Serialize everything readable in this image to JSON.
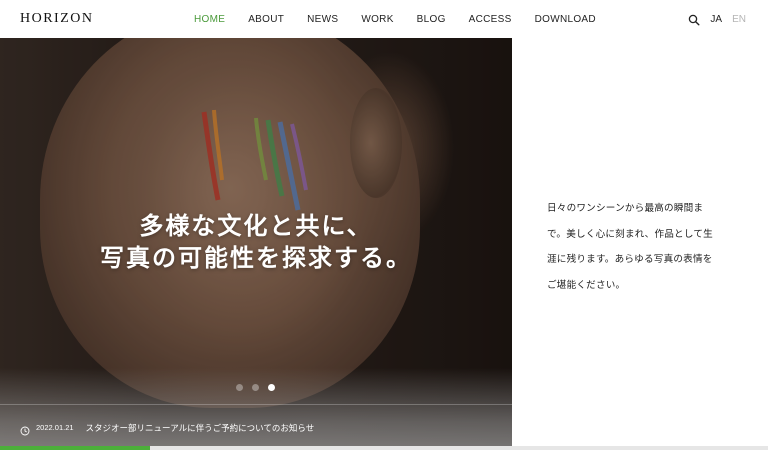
{
  "header": {
    "logo": "HORIZON",
    "nav": [
      {
        "label": "HOME",
        "active": true
      },
      {
        "label": "ABOUT",
        "active": false
      },
      {
        "label": "NEWS",
        "active": false
      },
      {
        "label": "WORK",
        "active": false
      },
      {
        "label": "BLOG",
        "active": false
      },
      {
        "label": "ACCESS",
        "active": false
      },
      {
        "label": "DOWNLOAD",
        "active": false
      }
    ],
    "search_icon": "search-icon",
    "lang": {
      "ja": "JA",
      "en": "EN",
      "active": "JA"
    }
  },
  "hero": {
    "title_line1": "多様な文化と共に、",
    "title_line2": "写真の可能性を探求する。",
    "slides": {
      "count": 3,
      "active": 3
    },
    "news": {
      "date": "2022.01.21",
      "text": "スタジオー部リニューアルに伴うご予約についてのお知らせ"
    },
    "progress": 0.195
  },
  "intro": {
    "lines": [
      "日々のワンシーンから最高の瞬間ま",
      "で。美しく心に刻まれ、作品として生",
      "涯に残ります。あらゆる写真の表情を",
      "ご堪能ください。"
    ]
  },
  "colors": {
    "accent": "#4a9a3a",
    "progress": "#4caf3a",
    "text": "#222222",
    "inactive": "#b5b5b5"
  }
}
